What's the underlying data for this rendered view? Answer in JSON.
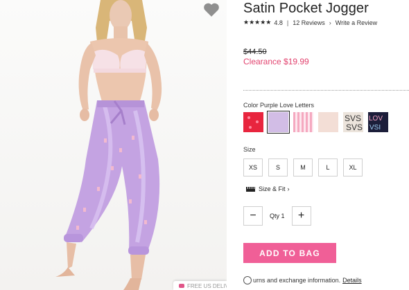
{
  "product": {
    "title": "Satin Pocket Jogger",
    "rating_stars": "★★★★★",
    "rating_value": "4.8",
    "reviews_link": "12 Reviews",
    "write_review": "Write a Review",
    "price_original": "$44.50",
    "price_clearance": "Clearance $19.99"
  },
  "color": {
    "label": "Color Purple Love Letters",
    "selected_index": 1,
    "swatches": [
      {
        "name": "red-hearts",
        "color": "#e8253e"
      },
      {
        "name": "purple-love-letters",
        "color": "#d2bde6"
      },
      {
        "name": "pink-stripe",
        "color": "#f5a9c0"
      },
      {
        "name": "blush",
        "color": "#f3ded6"
      },
      {
        "name": "leopard",
        "color": "#d9cfc7"
      },
      {
        "name": "navy-love",
        "color": "#1c1e3a"
      }
    ]
  },
  "size": {
    "label": "Size",
    "options": [
      "XS",
      "S",
      "M",
      "L",
      "XL"
    ]
  },
  "fit": {
    "label": "Size & Fit",
    "chevron": "›"
  },
  "quantity": {
    "minus": "−",
    "label": "Qty 1",
    "plus": "+"
  },
  "cart": {
    "add_label": "ADD TO BAG"
  },
  "returns": {
    "text": "urns and exchange information.",
    "link": "Details"
  },
  "promo": {
    "text": "FREE US DELIVERY"
  },
  "colors": {
    "accent": "#f05f97",
    "clearance": "#e2426e"
  }
}
